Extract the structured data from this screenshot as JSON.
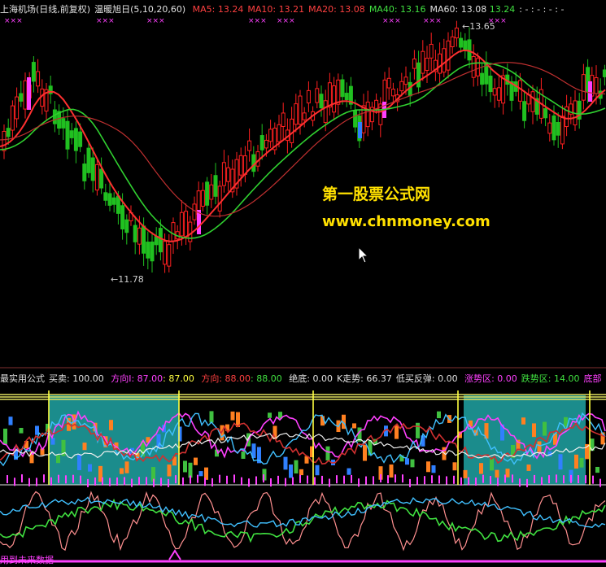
{
  "main_header": {
    "stock_name": "上海机场",
    "period": "(日线,前复权)",
    "indicator_name": "温暖旭日",
    "params": "(5,10,20,60)",
    "ma5": "MA5: 13.24",
    "ma10": "MA10: 13.21",
    "ma20": "MA20: 13.08",
    "ma40": "MA40: 13.16",
    "ma60": "MA60: 13.08",
    "last": "13.24",
    "dashes": ": - : - : - : -"
  },
  "annotations": {
    "high": "←13.65",
    "low": "←11.78"
  },
  "watermark": {
    "line1": "第一股票公式网",
    "line2": "www.chnmoney.com"
  },
  "sub_header": {
    "title": "最实用公式",
    "buy_sell": "买卖: 100.00",
    "dir1": "方向I: 87.00",
    "dir1b": ": 87.00",
    "dir2": "方向: 88.00",
    "dir2b": ": 88.00",
    "bottom": "绝底: 0.00",
    "k_trend": "K走势: 66.37",
    "rebound": "低买反弹: 0.00",
    "rise_zone": "涨势区: 0.00",
    "fall_zone": "跌势区: 14.00",
    "cut_label": "底部"
  },
  "footer": {
    "text": "用到未来数据"
  },
  "colors": {
    "up": "#ff2020",
    "down": "#20c020",
    "ma_red": "#ff3030",
    "ma_green": "#30d030",
    "teal": "#1b8c8c",
    "magenta": "#ff40ff",
    "yellow": "#ffff40"
  }
}
